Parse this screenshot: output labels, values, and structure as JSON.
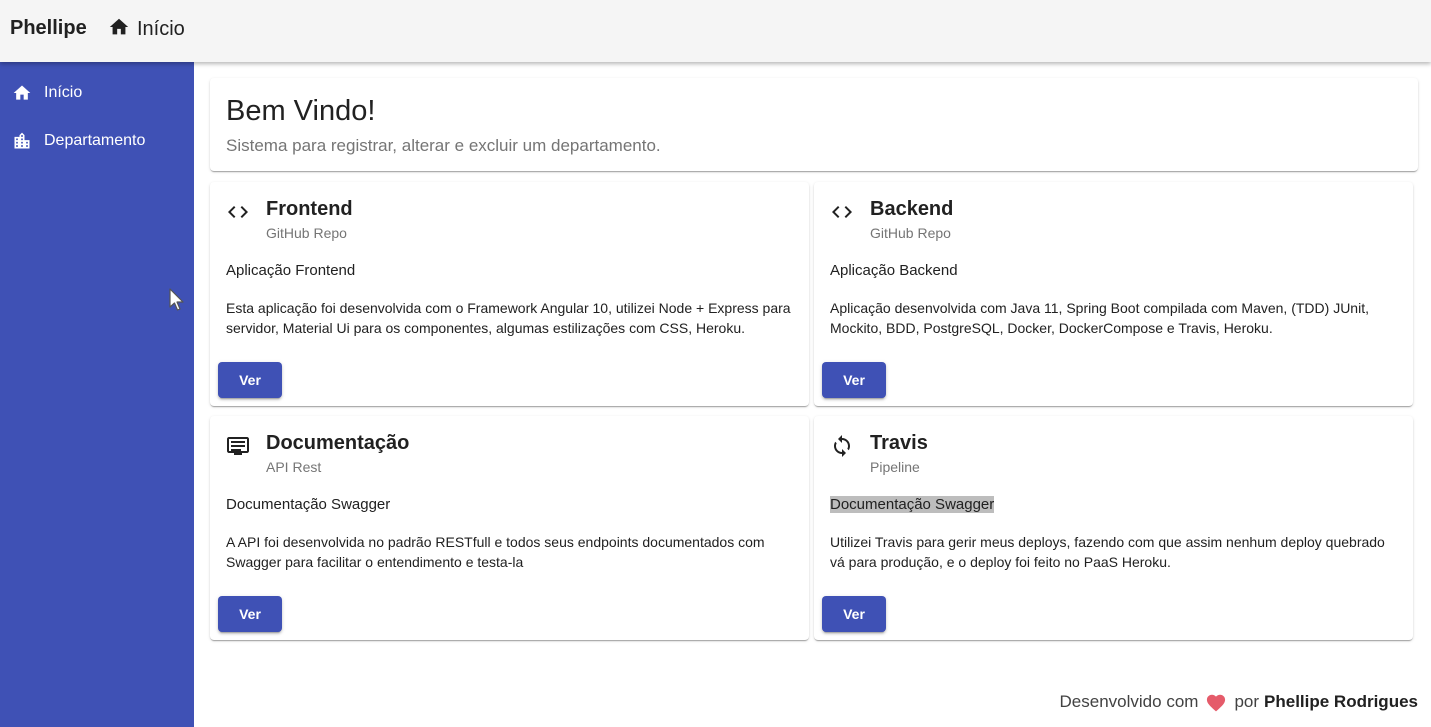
{
  "header": {
    "brand": "Phellipe",
    "home_link": {
      "label": "Início",
      "icon": "home-icon"
    }
  },
  "sidebar": {
    "items": [
      {
        "label": "Início",
        "icon": "home-icon"
      },
      {
        "label": "Departamento",
        "icon": "building-icon"
      }
    ]
  },
  "welcome": {
    "title": "Bem Vindo!",
    "subtitle": "Sistema para registrar, alterar e excluir um departamento."
  },
  "cards": [
    {
      "icon": "code-icon",
      "title": "Frontend",
      "subtitle": "GitHub Repo",
      "heading": "Aplicação Frontend",
      "description": "Esta aplicação foi desenvolvida com o Framework Angular 10, utilizei Node + Express para servidor, Material Ui para os componentes, algumas estilizações com CSS, Heroku.",
      "button": "Ver"
    },
    {
      "icon": "code-icon",
      "title": "Backend",
      "subtitle": "GitHub Repo",
      "heading": "Aplicação Backend",
      "description": "Aplicação desenvolvida com Java 11, Spring Boot compilada com Maven, (TDD) JUnit, Mockito, BDD, PostgreSQL, Docker, DockerCompose e Travis, Heroku.",
      "button": "Ver"
    },
    {
      "icon": "document-icon",
      "title": "Documentação",
      "subtitle": "API Rest",
      "heading": "Documentação Swagger",
      "description": "A API foi desenvolvida no padrão RESTfull e todos seus endpoints documentados com Swagger para facilitar o entendimento e testa-la",
      "button": "Ver"
    },
    {
      "icon": "sync-icon",
      "title": "Travis",
      "subtitle": "Pipeline",
      "heading": "Documentação Swagger",
      "description": "Utilizei Travis para gerir meus deploys, fazendo com que assim nenhum deploy quebrado vá para produção, e o deploy foi feito no PaaS Heroku.",
      "button": "Ver"
    }
  ],
  "footer": {
    "prefix": "Desenvolvido com",
    "icon": "heart-icon",
    "by": "por",
    "author": "Phellipe Rodrigues"
  },
  "colors": {
    "primary": "#3f51b5",
    "toolbar": "#f5f5f5",
    "heart": "#e55b6a",
    "highlight": "#bdbdbd"
  }
}
